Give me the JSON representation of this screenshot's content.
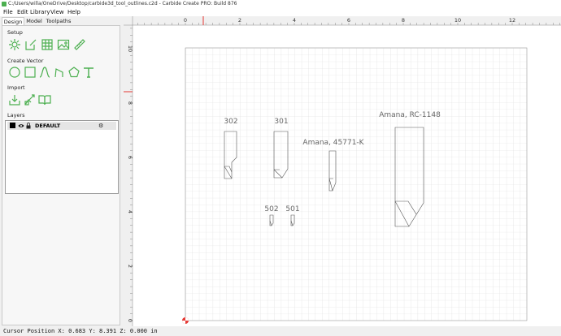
{
  "window": {
    "title": "C:/Users/willa/OneDrive/Desktop/carbide3d_tool_outlines.c2d - Carbide Create PRO: Build 876"
  },
  "menu": {
    "file": "File",
    "edit": "Edit",
    "library": "Library",
    "view": "View",
    "help": "Help"
  },
  "tabs": {
    "design": "Design",
    "model": "Model",
    "toolpaths": "Toolpaths"
  },
  "sections": {
    "setup": "Setup",
    "create_vector": "Create Vector",
    "import": "Import",
    "layers": "Layers"
  },
  "tool_icons": {
    "setup": [
      "job-setup-icon",
      "edit-square-icon",
      "grid-icon",
      "image-icon",
      "ruler-icon"
    ],
    "create_vector": [
      "circle-icon",
      "rectangle-icon",
      "curve-icon",
      "polyline-icon",
      "polygon-icon",
      "text-icon"
    ],
    "import": [
      "import-icon",
      "import-svg-icon",
      "library-book-icon"
    ]
  },
  "layers": [
    {
      "name": "DEFAULT",
      "color": "#000000"
    }
  ],
  "ruler": {
    "top_labels": [
      "0",
      "2",
      "4",
      "6",
      "8",
      "10",
      "12"
    ],
    "left_labels": [
      "10",
      "8",
      "6",
      "4",
      "2",
      "0"
    ]
  },
  "canvas": {
    "labels": {
      "t302": "302",
      "t301": "301",
      "amana45771": "Amana, 45771-K",
      "amanaRC": "Amana, RC-1148",
      "t502": "502",
      "t501": "501"
    }
  },
  "status": {
    "cursor": "Cursor Position X: 0.683 Y: 8.391 Z: 0.000 in"
  },
  "colors": {
    "accent_green": "#4caf50",
    "marker_red": "#e53935",
    "grid_line": "#dddddd",
    "panel_bg": "#f0f0f0"
  }
}
